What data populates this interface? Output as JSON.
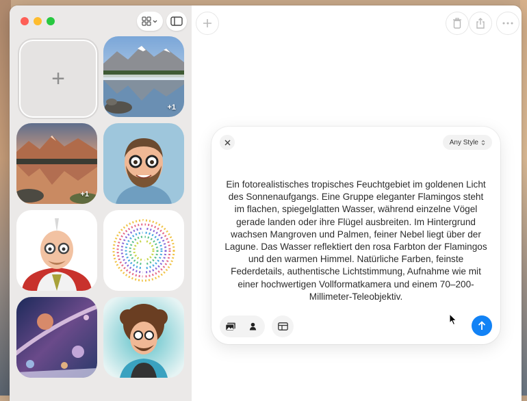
{
  "window": {
    "toolbar": {
      "grid_icon": "grid-view-icon",
      "sidebar_icon": "sidebar-toggle-icon",
      "add_icon": "plus-icon",
      "trash_icon": "trash-icon",
      "share_icon": "share-icon",
      "more_icon": "ellipsis-icon"
    }
  },
  "gallery": {
    "new_tile_symbol": "+",
    "items": [
      {
        "name": "mountain-lake-image",
        "badge": "+1"
      },
      {
        "name": "sunset-lake-image",
        "badge": "+1"
      },
      {
        "name": "bearded-man-avatar-image",
        "badge": ""
      },
      {
        "name": "scientist-cartoon-image",
        "badge": ""
      },
      {
        "name": "rainbow-brain-image",
        "badge": ""
      },
      {
        "name": "space-planets-image",
        "badge": ""
      },
      {
        "name": "curly-hair-man-avatar-image",
        "badge": ""
      }
    ]
  },
  "composer": {
    "style_label": "Any Style",
    "prompt": "Ein fotorealistisches tropisches Feuchtgebiet im goldenen Licht des Sonnenaufgangs. Eine Gruppe eleganter Flamingos steht im flachen, spiegelglatten Wasser, während einzelne Vögel gerade landen oder ihre Flügel ausbreiten. Im Hintergrund wachsen Mangroven und Palmen, feiner Nebel liegt über der Lagune. Das Wasser reflektiert den rosa Farbton der Flamingos und den warmen Himmel. Natürliche Farben, feinste Federdetails, authentische Lichtstimmung, Aufnahme wie mit einer hochwertigen Vollformatkamera und einem 70–200-Millimeter-Teleobjektiv.",
    "accent": "#1282f5"
  }
}
